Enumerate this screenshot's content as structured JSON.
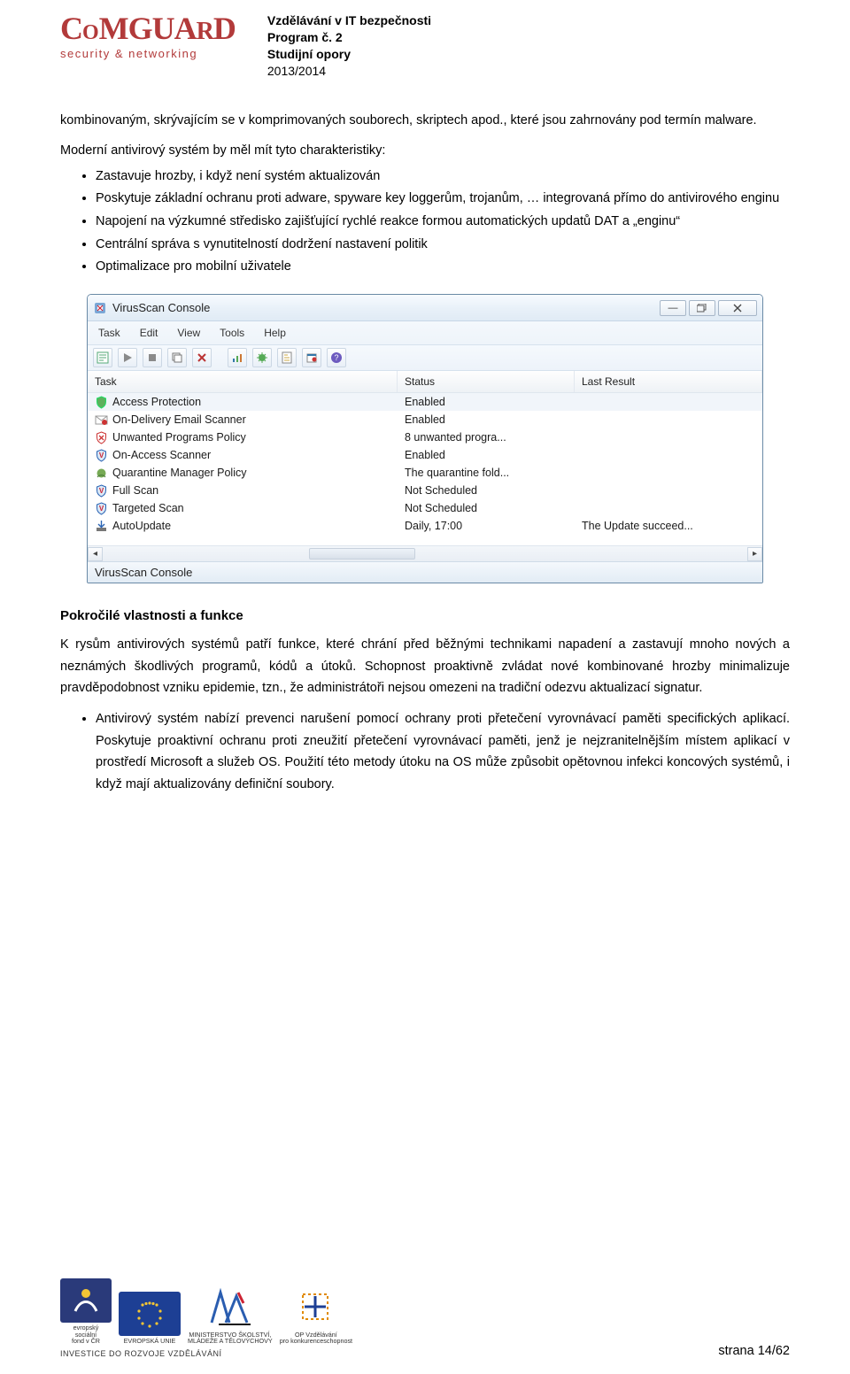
{
  "header": {
    "logo_text": "COMGUARD",
    "logo_tagline": "security & networking",
    "line1": "Vzdělávání v IT bezpečnosti",
    "line2": "Program č. 2",
    "line3": "Studijní opory",
    "line4": "2013/2014"
  },
  "intro_para": "kombinovaným, skrývajícím se v komprimovaných souborech, skriptech apod., které jsou zahrnovány pod termín malware.",
  "lead_in": "Moderní antivirový systém by měl mít tyto charakteristiky:",
  "bullets1": [
    "Zastavuje hrozby, i když není systém aktualizován",
    "Poskytuje základní ochranu proti adware, spyware key loggerům, trojanům, … integrovaná přímo do antivirového enginu",
    "Napojení na výzkumné středisko zajišťující rychlé reakce formou automatických updatů DAT a „enginu“",
    "Centrální správa s vynutitelností dodržení nastavení politik",
    "Optimalizace pro mobilní uživatele"
  ],
  "app": {
    "title": "VirusScan Console",
    "menu": [
      "Task",
      "Edit",
      "View",
      "Tools",
      "Help"
    ],
    "toolbar_icons": [
      "properties-icon",
      "play-icon",
      "stop-icon",
      "copy-icon",
      "delete-icon",
      "stats-icon",
      "virus-list-icon",
      "log-icon",
      "event-icon",
      "help-icon"
    ],
    "columns": {
      "c1": "Task",
      "c2": "Status",
      "c3": "Last Result"
    },
    "rows": [
      {
        "icon": "shield-green-icon",
        "task": "Access Protection",
        "status": "Enabled",
        "result": "",
        "selected": true
      },
      {
        "icon": "mail-shield-icon",
        "task": "On-Delivery Email Scanner",
        "status": "Enabled",
        "result": ""
      },
      {
        "icon": "shield-red-x-icon",
        "task": "Unwanted Programs Policy",
        "status": "8 unwanted progra...",
        "result": ""
      },
      {
        "icon": "shield-blue-v-icon",
        "task": "On-Access Scanner",
        "status": "Enabled",
        "result": ""
      },
      {
        "icon": "quarantine-icon",
        "task": "Quarantine Manager Policy",
        "status": "The quarantine fold...",
        "result": ""
      },
      {
        "icon": "shield-blue-v-icon",
        "task": "Full Scan",
        "status": "Not Scheduled",
        "result": ""
      },
      {
        "icon": "shield-blue-v-icon",
        "task": "Targeted Scan",
        "status": "Not Scheduled",
        "result": ""
      },
      {
        "icon": "update-icon",
        "task": "AutoUpdate",
        "status": "Daily, 17:00",
        "result": "The Update succeed..."
      }
    ],
    "status": "VirusScan Console"
  },
  "section_heading": "Pokročilé vlastnosti a funkce",
  "para2": "K rysům antivirových systémů patří funkce, které chrání před běžnými technikami napadení a zastavují mnoho nových a neznámých škodlivých programů, kódů a útoků. Schopnost proaktivně zvládat nové kombinované hrozby minimalizuje pravděpodobnost vzniku epidemie, tzn., že administrátoři nejsou omezeni na tradiční odezvu aktualizací signatur.",
  "bullets2": [
    "Antivirový systém nabízí prevenci narušení pomocí ochrany proti přetečení vyrovnávací paměti specifických aplikací. Poskytuje proaktivní ochranu proti zneužití přetečení vyrovnávací paměti, jenž je nejzranitelnějším místem aplikací v prostředí Microsoft a služeb OS. Použití této metody útoku na OS může způsobit opětovnou infekci koncových systémů, i když mají aktualizovány definiční soubory."
  ],
  "footer": {
    "logo1_caption": "evropský\nsociální\nfond v ČR",
    "logo2_caption": "EVROPSKÁ UNIE",
    "logo3_caption": "MINISTERSTVO ŠKOLSTVÍ,\nMLÁDEŽE A TĚLOVÝCHOVY",
    "logo4_caption": "OP Vzdělávání\npro konkurenceschopnost",
    "invest_line": "INVESTICE DO ROZVOJE VZDĚLÁVÁNÍ",
    "page_num": "strana 14/62"
  }
}
